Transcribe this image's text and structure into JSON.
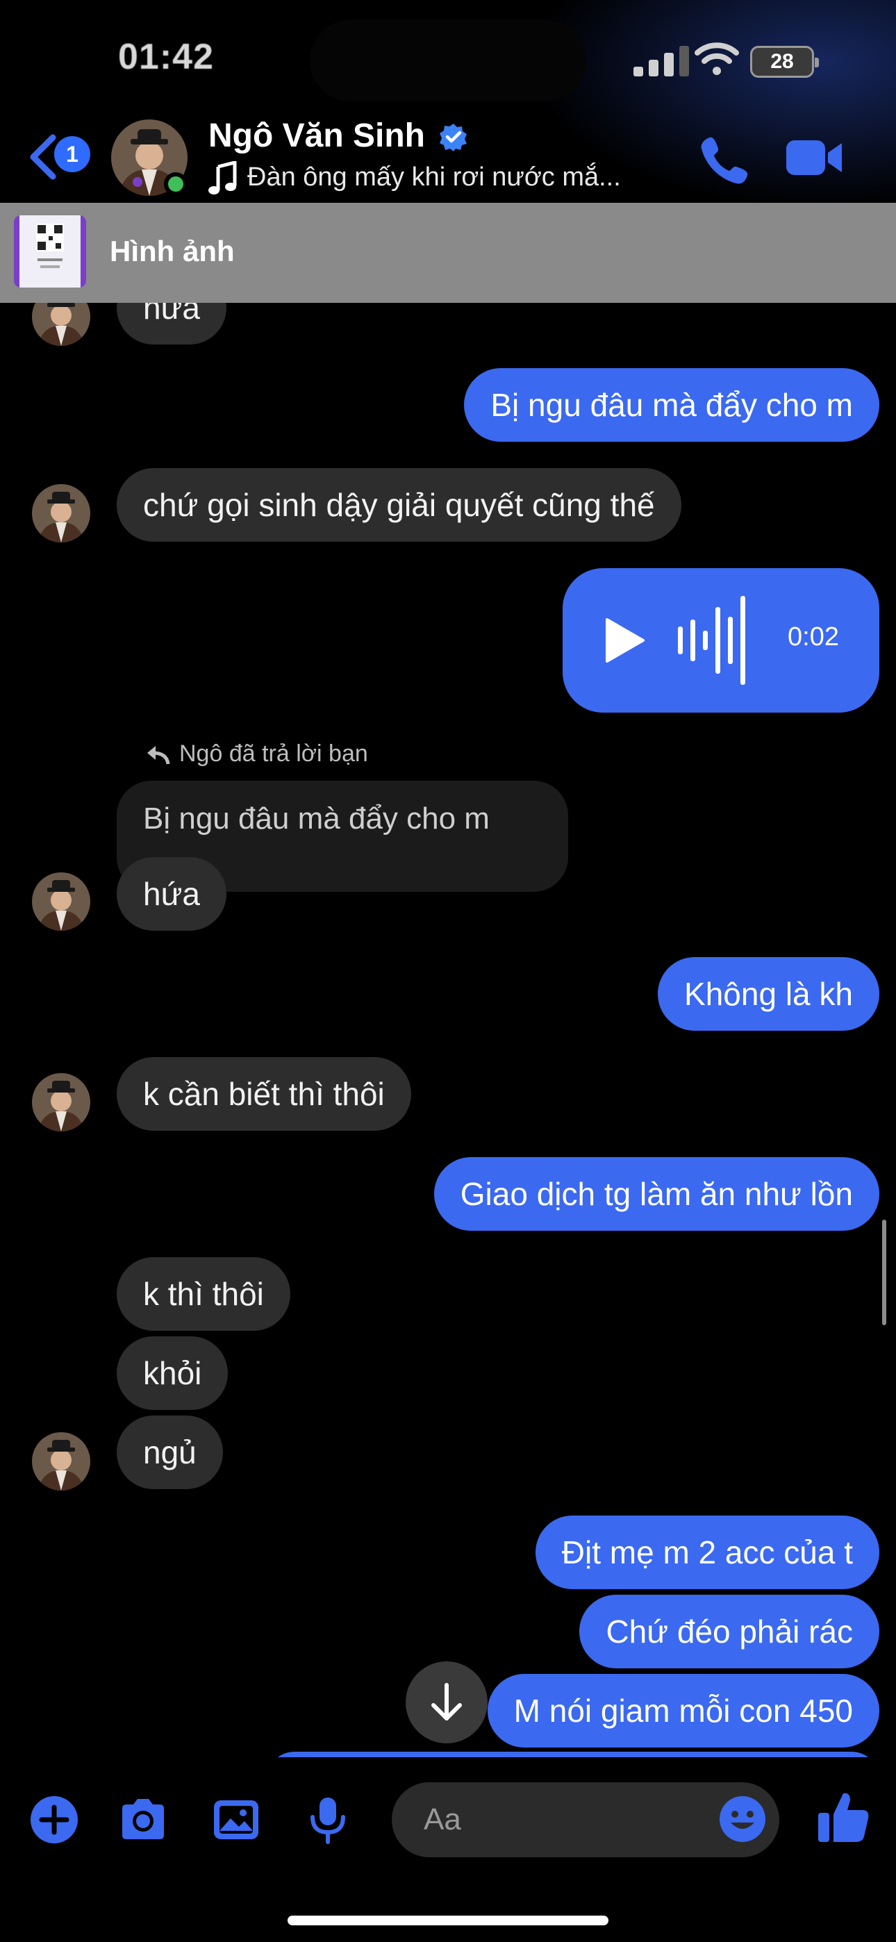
{
  "status_bar": {
    "time": "01:42",
    "battery": "28"
  },
  "header": {
    "unread_count": "1",
    "contact_name": "Ngô Văn Sinh",
    "now_playing": "Đàn ông mấy khi rơi nước mắ..."
  },
  "pinned": {
    "label": "Hình ảnh"
  },
  "messages": {
    "m0": "hứa",
    "m1": "Bị ngu đâu mà đẩy cho m",
    "m2": "chứ gọi sinh dậy giải quyết cũng thế",
    "voice_duration": "0:02",
    "reply_hint": "Ngô đã trả lời bạn",
    "reply_quote": "Bị ngu đâu mà đẩy cho m",
    "m3": "hứa",
    "m4": "Không là kh",
    "m5": "k cần biết thì thôi",
    "m6": "Giao dịch tg làm ăn như lồn",
    "m7": "k thì thôi",
    "m8": "khỏi",
    "m9": "ngủ",
    "m10": "Địt mẹ m 2 acc của t",
    "m11": "Chứ đéo phải rác",
    "m12": "M nói giam mỗi con 450"
  },
  "composer": {
    "placeholder": "Aa"
  },
  "colors": {
    "accent": "#3b69f0",
    "incoming_bubble": "#2d2d2d",
    "online": "#3fbe5a"
  },
  "icons": [
    "back-arrow-icon",
    "verified-icon",
    "music-note-icon",
    "phone-icon",
    "video-camera-icon",
    "play-icon",
    "waveform-icon",
    "reply-arrow-icon",
    "arrow-down-icon",
    "plus-icon",
    "camera-icon",
    "image-icon",
    "microphone-icon",
    "emoji-icon",
    "thumbs-up-icon"
  ]
}
